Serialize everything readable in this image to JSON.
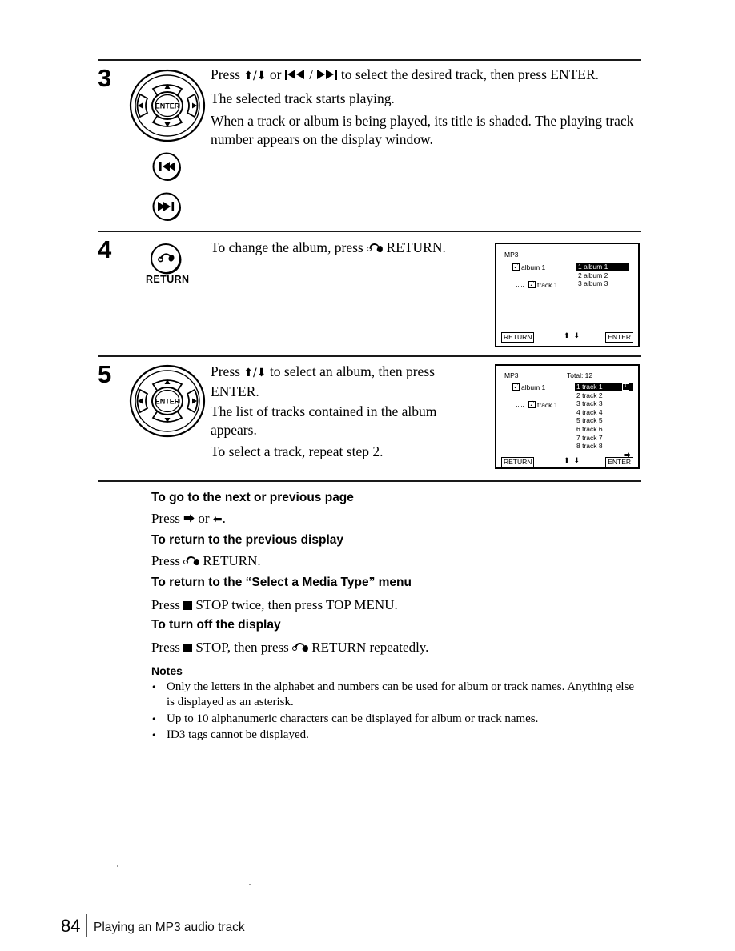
{
  "page": {
    "number": "84",
    "footer_title": "Playing an MP3 audio track"
  },
  "steps": [
    {
      "number": "3",
      "control_icons": [
        "dpad-enter-icon",
        "prev-track-button-icon",
        "next-track-button-icon"
      ],
      "paragraphs": [
        {
          "prefix": "Press ",
          "mid": " or ",
          "suffix": " to select the desired track, then press ENTER."
        },
        {
          "text": "The selected track starts playing."
        },
        {
          "text": "When a track or album is being played, its title is shaded.  The playing track number appears on the display window."
        }
      ]
    },
    {
      "number": "4",
      "control_icons": [
        "return-button-icon"
      ],
      "control_label": "RETURN",
      "paragraphs": [
        {
          "prefix": "To change the album, press ",
          "suffix": " RETURN."
        }
      ]
    },
    {
      "number": "5",
      "control_icons": [
        "dpad-enter-icon"
      ],
      "paragraphs": [
        {
          "prefix": "Press ",
          "suffix": " to select an album, then press ENTER."
        },
        {
          "text": "The list of tracks contained in the album appears."
        },
        {
          "text": "To select a track, repeat step 2."
        }
      ]
    }
  ],
  "dpad": {
    "center_label": "ENTER"
  },
  "screens": [
    {
      "id": "album-select-screen",
      "title": "MP3",
      "total": "",
      "tree": [
        {
          "label": "album 1",
          "icon": "music-folder-icon",
          "level": 0
        },
        {
          "label": "track 1",
          "icon": "music-note-icon",
          "level": 1
        }
      ],
      "list": [
        {
          "text": "1 album 1",
          "highlighted": true,
          "icon_right": ""
        },
        {
          "text": "2 album 2",
          "highlighted": false,
          "icon_right": ""
        },
        {
          "text": "3 album 3",
          "highlighted": false,
          "icon_right": ""
        }
      ],
      "return_button": "RETURN",
      "enter_button": "ENTER",
      "nav_arrows": "⬆ ⬇",
      "page_arrow": ""
    },
    {
      "id": "track-list-screen",
      "title": "MP3",
      "total": "Total: 12",
      "tree": [
        {
          "label": "album 1",
          "icon": "music-folder-icon",
          "level": 0
        },
        {
          "label": "track 1",
          "icon": "music-note-icon",
          "level": 1
        }
      ],
      "list": [
        {
          "text": "1 track 1",
          "highlighted": true,
          "icon_right": "music-note-icon"
        },
        {
          "text": "2 track 2",
          "highlighted": false,
          "icon_right": ""
        },
        {
          "text": "3 track 3",
          "highlighted": false,
          "icon_right": ""
        },
        {
          "text": "4 track 4",
          "highlighted": false,
          "icon_right": ""
        },
        {
          "text": "5 track 5",
          "highlighted": false,
          "icon_right": ""
        },
        {
          "text": "6 track 6",
          "highlighted": false,
          "icon_right": ""
        },
        {
          "text": "7 track 7",
          "highlighted": false,
          "icon_right": ""
        },
        {
          "text": "8 track 8",
          "highlighted": false,
          "icon_right": ""
        }
      ],
      "return_button": "RETURN",
      "enter_button": "ENTER",
      "nav_arrows": "⬆ ⬇",
      "page_arrow": "⮕"
    }
  ],
  "sections": [
    {
      "heading": "To go to the next or previous page",
      "body_prefix": "Press ",
      "body_mid": " or ",
      "body_suffix": "."
    },
    {
      "heading": "To return to the previous display",
      "body_prefix": "Press ",
      "body_suffix": " RETURN."
    },
    {
      "heading": "To return to the “Select a Media Type” menu",
      "body_prefix": "Press ",
      "body_mid": " STOP twice, then press TOP MENU.",
      "body_suffix": ""
    },
    {
      "heading": "To turn off  the display",
      "body_prefix": "Press ",
      "body_mid": " STOP, then press ",
      "body_suffix": " RETURN repeatedly."
    }
  ],
  "notes": {
    "heading": "Notes",
    "bullet_glyph": "•",
    "items": [
      "Only the letters in the alphabet and numbers can be used for album or track names.  Anything else is displayed as an asterisk.",
      "Up to 10 alphanumeric characters can be displayed for album or track names.",
      "ID3 tags cannot be displayed."
    ]
  }
}
